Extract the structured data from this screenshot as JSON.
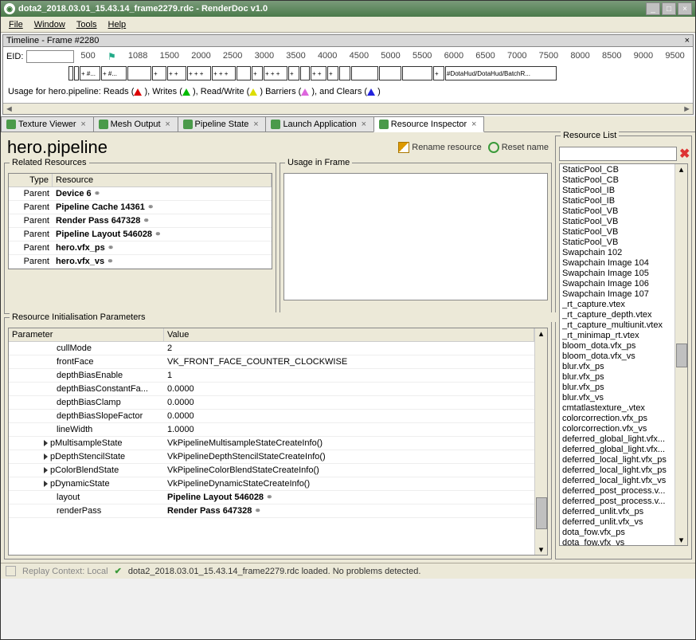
{
  "window": {
    "title": "dota2_2018.03.01_15.43.14_frame2279.rdc - RenderDoc v1.0"
  },
  "menu": {
    "file": "File",
    "window": "Window",
    "tools": "Tools",
    "help": "Help"
  },
  "timeline": {
    "title": "Timeline - Frame #2280",
    "eid_label": "EID:",
    "ticks": [
      "500",
      "1088",
      "1500",
      "2000",
      "2500",
      "3000",
      "3500",
      "4000",
      "4500",
      "5000",
      "5500",
      "6000",
      "6500",
      "7000",
      "7500",
      "8000",
      "8500",
      "9000",
      "9500"
    ],
    "lastbox": "#DotaHud/DotaHud/BatchR...",
    "usage_prefix": "Usage for hero.pipeline: Reads (",
    "writes": "), Writes (",
    "rw": "), Read/Write (",
    "barriers": ") Barriers (",
    "clears": "), and Clears (",
    "end": ")"
  },
  "tabs": [
    {
      "label": "Texture Viewer"
    },
    {
      "label": "Mesh Output"
    },
    {
      "label": "Pipeline State"
    },
    {
      "label": "Launch Application"
    },
    {
      "label": "Resource Inspector",
      "active": true
    }
  ],
  "inspector": {
    "title": "hero.pipeline",
    "rename": "Rename resource",
    "reset": "Reset name",
    "related_title": "Related Resources",
    "usage_title": "Usage in Frame",
    "related_headers": {
      "type": "Type",
      "resource": "Resource"
    },
    "related": [
      {
        "type": "Parent",
        "res": "Device 6"
      },
      {
        "type": "Parent",
        "res": "Pipeline Cache 14361"
      },
      {
        "type": "Parent",
        "res": "Render Pass 647328"
      },
      {
        "type": "Parent",
        "res": "Pipeline Layout 546028"
      },
      {
        "type": "Parent",
        "res": "hero.vfx_ps"
      },
      {
        "type": "Parent",
        "res": "hero.vfx_vs"
      }
    ],
    "params_title": "Resource Initialisation Parameters",
    "param_headers": {
      "param": "Parameter",
      "value": "Value"
    },
    "params": [
      {
        "p": "cullMode",
        "v": "2"
      },
      {
        "p": "frontFace",
        "v": "VK_FRONT_FACE_COUNTER_CLOCKWISE"
      },
      {
        "p": "depthBiasEnable",
        "v": "1"
      },
      {
        "p": "depthBiasConstantFa...",
        "v": "0.0000"
      },
      {
        "p": "depthBiasClamp",
        "v": "0.0000"
      },
      {
        "p": "depthBiasSlopeFactor",
        "v": "0.0000"
      },
      {
        "p": "lineWidth",
        "v": "1.0000"
      },
      {
        "p": "pMultisampleState",
        "v": "VkPipelineMultisampleStateCreateInfo()",
        "exp": true
      },
      {
        "p": "pDepthStencilState",
        "v": "VkPipelineDepthStencilStateCreateInfo()",
        "exp": true
      },
      {
        "p": "pColorBlendState",
        "v": "VkPipelineColorBlendStateCreateInfo()",
        "exp": true
      },
      {
        "p": "pDynamicState",
        "v": "VkPipelineDynamicStateCreateInfo()",
        "exp": true
      },
      {
        "p": "layout",
        "v": "Pipeline Layout 546028",
        "bold": true,
        "link": true
      },
      {
        "p": "renderPass",
        "v": "Render Pass 647328",
        "bold": true,
        "link": true
      }
    ]
  },
  "reslist": {
    "title": "Resource List",
    "items": [
      "StaticPool_CB",
      "StaticPool_CB",
      "StaticPool_IB",
      "StaticPool_IB",
      "StaticPool_VB",
      "StaticPool_VB",
      "StaticPool_VB",
      "StaticPool_VB",
      "Swapchain 102",
      "Swapchain Image 104",
      "Swapchain Image 105",
      "Swapchain Image 106",
      "Swapchain Image 107",
      "_rt_capture.vtex",
      "_rt_capture_depth.vtex",
      "_rt_capture_multiunit.vtex",
      "_rt_minimap_rt.vtex",
      "bloom_dota.vfx_ps",
      "bloom_dota.vfx_vs",
      "blur.vfx_ps",
      "blur.vfx_ps",
      "blur.vfx_ps",
      "blur.vfx_vs",
      "cmtatlastexture_.vtex",
      "colorcorrection.vfx_ps",
      "colorcorrection.vfx_vs",
      "deferred_global_light.vfx...",
      "deferred_global_light.vfx...",
      "deferred_local_light.vfx_ps",
      "deferred_local_light.vfx_ps",
      "deferred_local_light.vfx_vs",
      "deferred_post_process.v...",
      "deferred_post_process.v...",
      "deferred_unlit.vfx_ps",
      "deferred_unlit.vfx_vs",
      "dota_fow.vfx_ps",
      "dota_fow.vfx_vs"
    ]
  },
  "status": {
    "context": "Replay Context: Local",
    "msg": "dota2_2018.03.01_15.43.14_frame2279.rdc loaded. No problems detected."
  }
}
